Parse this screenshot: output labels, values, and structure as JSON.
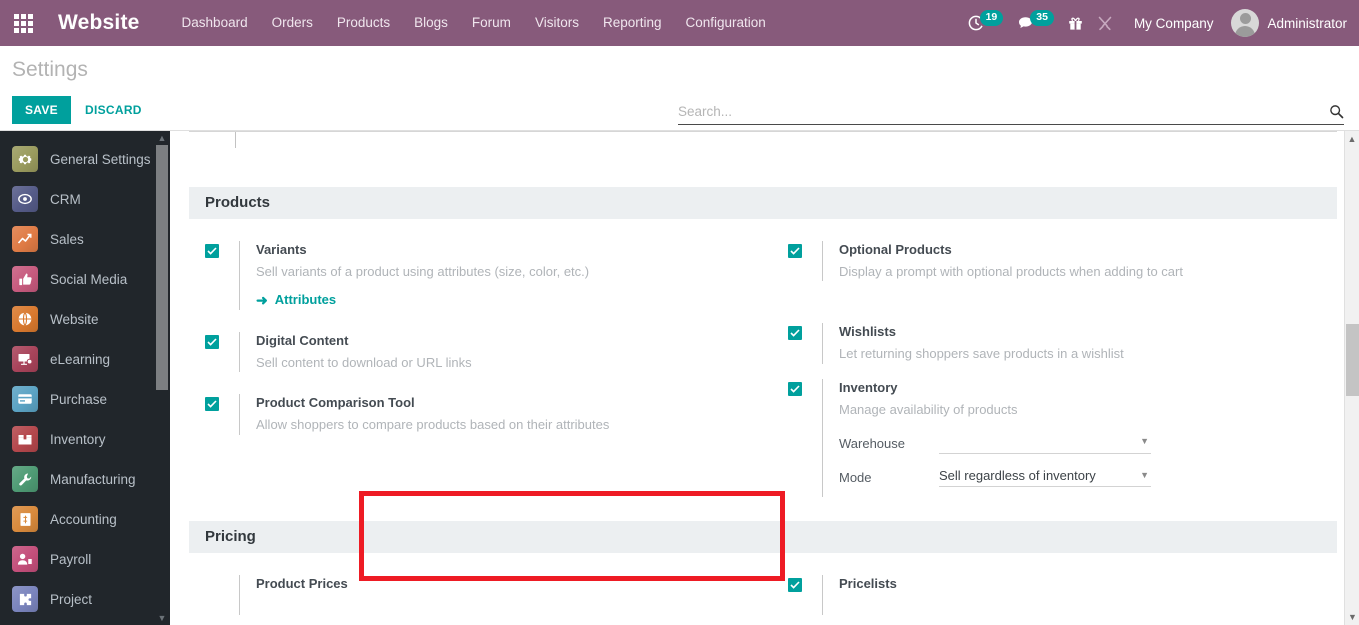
{
  "navbar": {
    "brand": "Website",
    "apps_icon": "apps-grid-icon",
    "menu": [
      {
        "label": "Dashboard"
      },
      {
        "label": "Orders"
      },
      {
        "label": "Products"
      },
      {
        "label": "Blogs"
      },
      {
        "label": "Forum"
      },
      {
        "label": "Visitors"
      },
      {
        "label": "Reporting"
      },
      {
        "label": "Configuration"
      }
    ],
    "activity": {
      "icon": "clock-activity-icon",
      "count": "19"
    },
    "messages": {
      "icon": "chat-bubble-icon",
      "count": "35"
    },
    "gift": {
      "icon": "gift-icon"
    },
    "tools": {
      "icon": "wrench-tools-icon"
    },
    "company": "My Company",
    "user": "Administrator",
    "avatar_icon": "user-avatar-icon",
    "bg_color": "#875a7b",
    "badge_color": "#00a09d"
  },
  "control_panel": {
    "title": "Settings",
    "save_label": "SAVE",
    "discard_label": "DISCARD",
    "accent_color": "#00a09d"
  },
  "search": {
    "placeholder": "Search...",
    "value": "",
    "icon": "search-icon"
  },
  "sidebar": {
    "items": [
      {
        "label": "General Settings",
        "icon": "gear-icon",
        "color": "#9a9b5e"
      },
      {
        "label": "CRM",
        "icon": "handshake-icon",
        "color": "#555b88"
      },
      {
        "label": "Sales",
        "icon": "chart-line-icon",
        "color": "#e07b45"
      },
      {
        "label": "Social Media",
        "icon": "thumbs-up-icon",
        "color": "#c75a7e"
      },
      {
        "label": "Website",
        "icon": "globe-icon",
        "color": "#d9792e"
      },
      {
        "label": "eLearning",
        "icon": "presentation-icon",
        "color": "#a8435a"
      },
      {
        "label": "Purchase",
        "icon": "card-icon",
        "color": "#5ba3c4"
      },
      {
        "label": "Inventory",
        "icon": "box-icon",
        "color": "#b4474c"
      },
      {
        "label": "Manufacturing",
        "icon": "wrench-icon",
        "color": "#4e9b74"
      },
      {
        "label": "Accounting",
        "icon": "invoice-icon",
        "color": "#d98a3c"
      },
      {
        "label": "Payroll",
        "icon": "person-badge-icon",
        "color": "#c44f7b"
      },
      {
        "label": "Project",
        "icon": "puzzle-icon",
        "color": "#7a84bd"
      }
    ],
    "scroll_up_icon": "chevron-up-icon",
    "scroll_down_icon": "chevron-down-icon"
  },
  "settings": {
    "sections": [
      {
        "title": "Products",
        "left": [
          {
            "name": "variants",
            "checked": true,
            "title": "Variants",
            "desc": "Sell variants of a product using attributes (size, color, etc.)",
            "link": "Attributes",
            "link_icon": "arrow-right-icon"
          },
          {
            "name": "digital-content",
            "checked": true,
            "title": "Digital Content",
            "desc": "Sell content to download or URL links"
          },
          {
            "name": "product-comparison-tool",
            "checked": true,
            "title": "Product Comparison Tool",
            "desc": "Allow shoppers to compare products based on their attributes",
            "highlighted": true
          }
        ],
        "right": [
          {
            "name": "optional-products",
            "checked": true,
            "title": "Optional Products",
            "desc": "Display a prompt with optional products when adding to cart"
          },
          {
            "name": "wishlists",
            "checked": true,
            "title": "Wishlists",
            "desc": "Let returning shoppers save products in a wishlist"
          },
          {
            "name": "inventory",
            "checked": true,
            "title": "Inventory",
            "desc": "Manage availability of products",
            "fields": [
              {
                "label": "Warehouse",
                "value": "",
                "name": "warehouse-select"
              },
              {
                "label": "Mode",
                "value": "Sell regardless of inventory",
                "name": "mode-select"
              }
            ]
          }
        ]
      },
      {
        "title": "Pricing",
        "left": [
          {
            "name": "product-prices",
            "checked": false,
            "title": "Product Prices",
            "desc": ""
          }
        ],
        "right": [
          {
            "name": "pricelists",
            "checked": true,
            "title": "Pricelists",
            "desc": ""
          }
        ]
      }
    ],
    "highlight_color": "#ee1b24"
  }
}
